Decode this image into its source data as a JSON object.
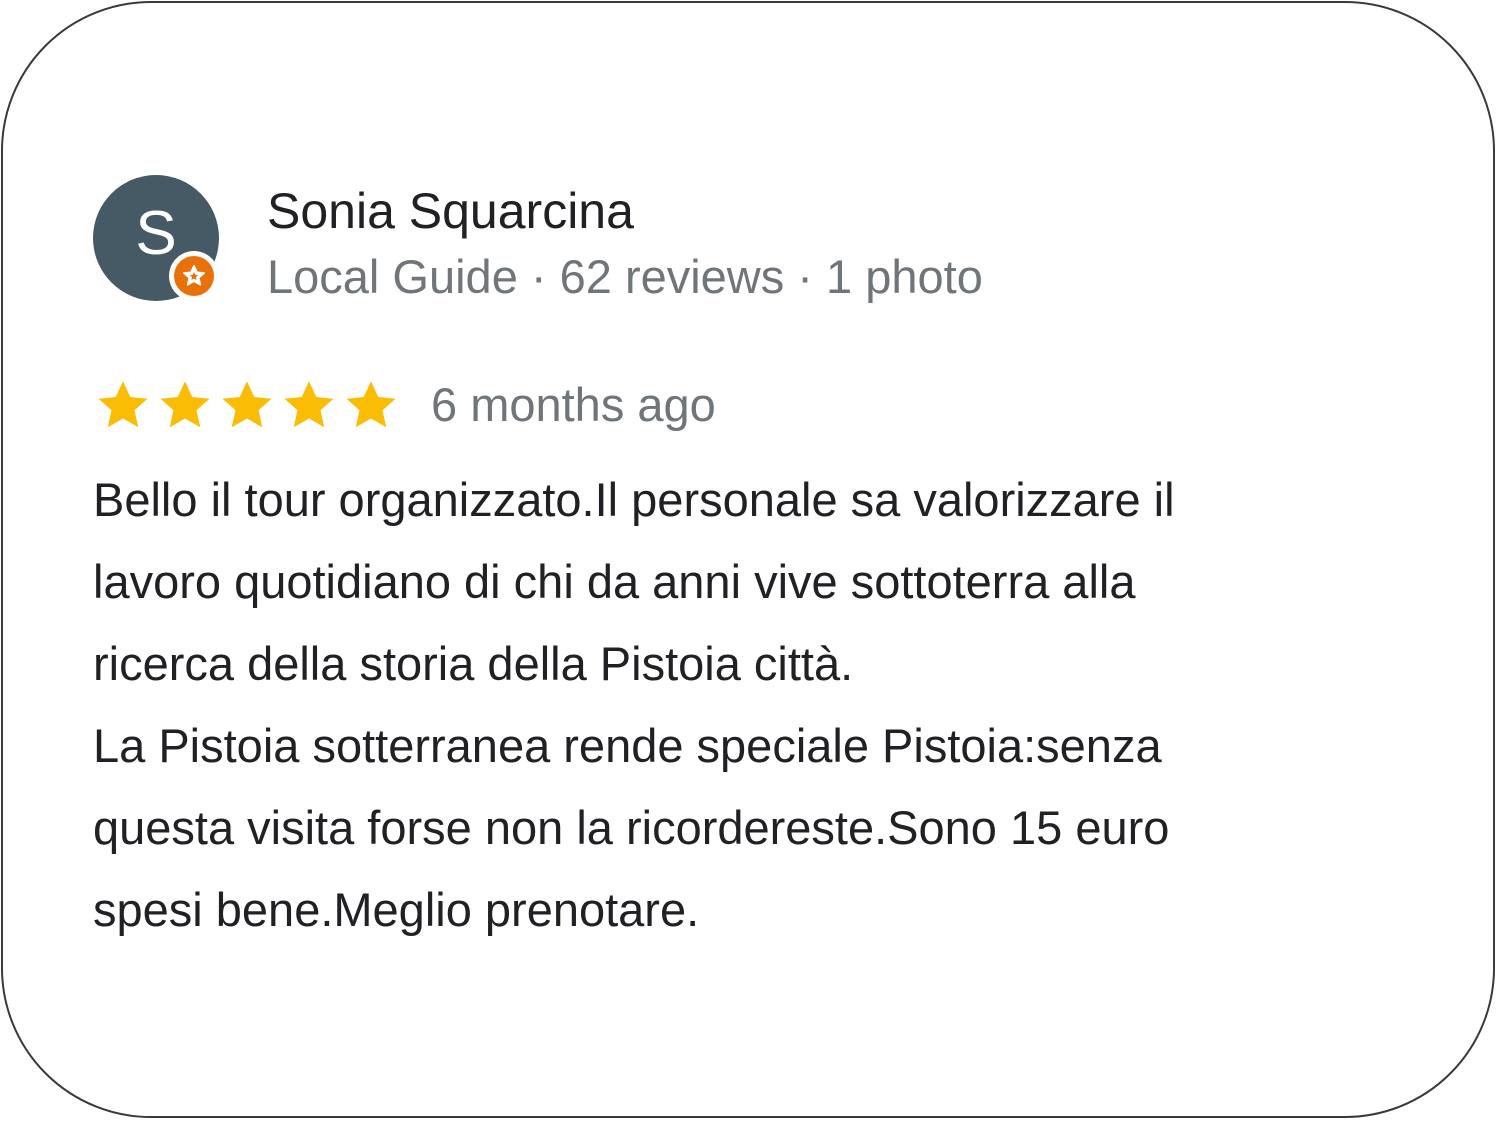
{
  "review": {
    "reviewer": {
      "avatar_letter": "S",
      "avatar_color": "#455a64",
      "badge_icon": "local-guide-star-icon",
      "badge_color": "#e8710a",
      "name": "Sonia Squarcina",
      "meta": "Local Guide · 62 reviews · 1 photo"
    },
    "rating": {
      "stars": 5,
      "max_stars": 5,
      "star_color": "#fbbc04"
    },
    "time_ago": "6 months ago",
    "text_lines": [
      "Bello il tour organizzato.Il personale sa valorizzare il",
      "lavoro quotidiano di chi da anni vive sottoterra alla",
      "ricerca della storia della Pistoia città.",
      "La Pistoia sotterranea rende speciale Pistoia:senza",
      "questa visita forse non la ricordereste.Sono 15 euro",
      "spesi bene.Meglio prenotare."
    ]
  }
}
